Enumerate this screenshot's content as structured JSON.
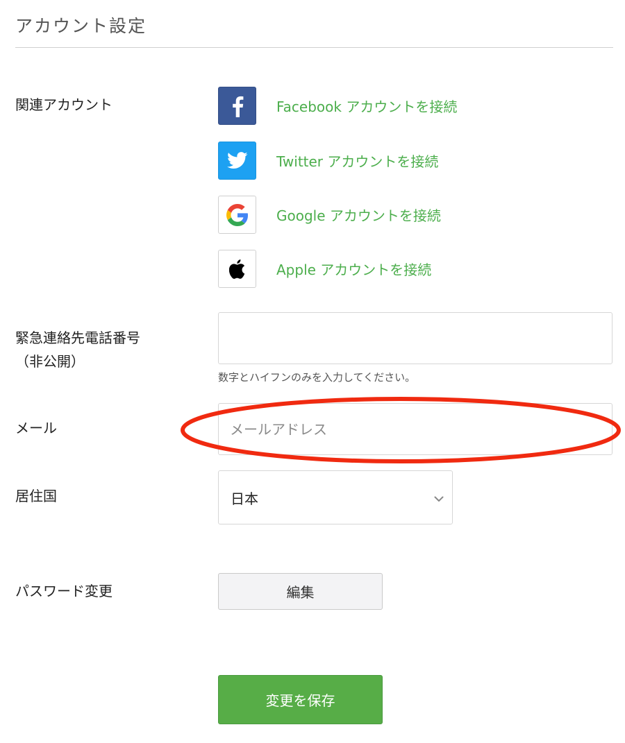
{
  "page": {
    "title": "アカウント設定"
  },
  "linked_accounts": {
    "label": "関連アカウント",
    "items": [
      {
        "provider": "facebook",
        "icon": "facebook-icon",
        "link_text": "Facebook アカウントを接続"
      },
      {
        "provider": "twitter",
        "icon": "twitter-icon",
        "link_text": "Twitter アカウントを接続"
      },
      {
        "provider": "google",
        "icon": "google-icon",
        "link_text": "Google アカウントを接続"
      },
      {
        "provider": "apple",
        "icon": "apple-icon",
        "link_text": "Apple アカウントを接続"
      }
    ]
  },
  "emergency_phone": {
    "label_line1": "緊急連絡先電話番号",
    "label_line2": "（非公開）",
    "value": "",
    "placeholder": "",
    "help_text": "数字とハイフンのみを入力してください。"
  },
  "email": {
    "label": "メール",
    "value": "",
    "placeholder": "メールアドレス"
  },
  "country": {
    "label": "居住国",
    "selected": "日本"
  },
  "password": {
    "label": "パスワード変更",
    "button_label": "編集"
  },
  "save": {
    "button_label": "変更を保存"
  },
  "colors": {
    "link_green": "#4cae4c",
    "save_green": "#57ad47",
    "facebook_blue": "#3b5998",
    "twitter_blue": "#1da1f2",
    "annotation_red": "#f02a10"
  }
}
